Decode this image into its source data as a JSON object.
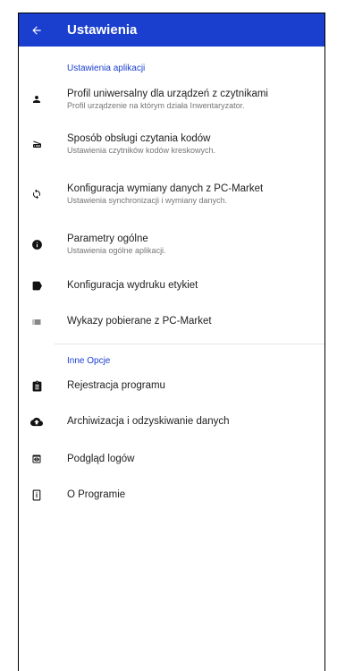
{
  "appbar": {
    "title": "Ustawienia",
    "back_icon": "arrow-back-icon"
  },
  "sections": [
    {
      "header": "Ustawienia aplikacji",
      "items": [
        {
          "icon": "person-icon",
          "title": "Profil uniwersalny dla urządzeń z czytnikami",
          "subtitle": "Profil urządzenie na którym działa Inwentaryzator."
        },
        {
          "icon": "scanner-icon",
          "title": "Sposób obsługi czytania kodów",
          "subtitle": "Ustawienia czytników kodów kreskowych."
        },
        {
          "icon": "sync-icon",
          "title": "Konfiguracja wymiany danych z PC-Market",
          "subtitle": "Ustawienia synchronizacji i wymiany danych."
        },
        {
          "icon": "info-icon",
          "title": "Parametry ogólne",
          "subtitle": "Ustawienia ogólne aplikacji."
        },
        {
          "icon": "label-icon",
          "title": "Konfiguracja wydruku etykiet",
          "subtitle": ""
        },
        {
          "icon": "list-icon",
          "title": "Wykazy pobierane z PC-Market",
          "subtitle": ""
        }
      ]
    },
    {
      "header": "Inne Opcje",
      "items": [
        {
          "icon": "clipboard-icon",
          "title": "Rejestracja programu",
          "subtitle": ""
        },
        {
          "icon": "cloud-upload-icon",
          "title": "Archiwizacja i odzyskiwanie danych",
          "subtitle": ""
        },
        {
          "icon": "preview-icon",
          "title": "Podgląd logów",
          "subtitle": ""
        },
        {
          "icon": "info-outline-icon",
          "title": "O Programie",
          "subtitle": ""
        }
      ]
    }
  ]
}
